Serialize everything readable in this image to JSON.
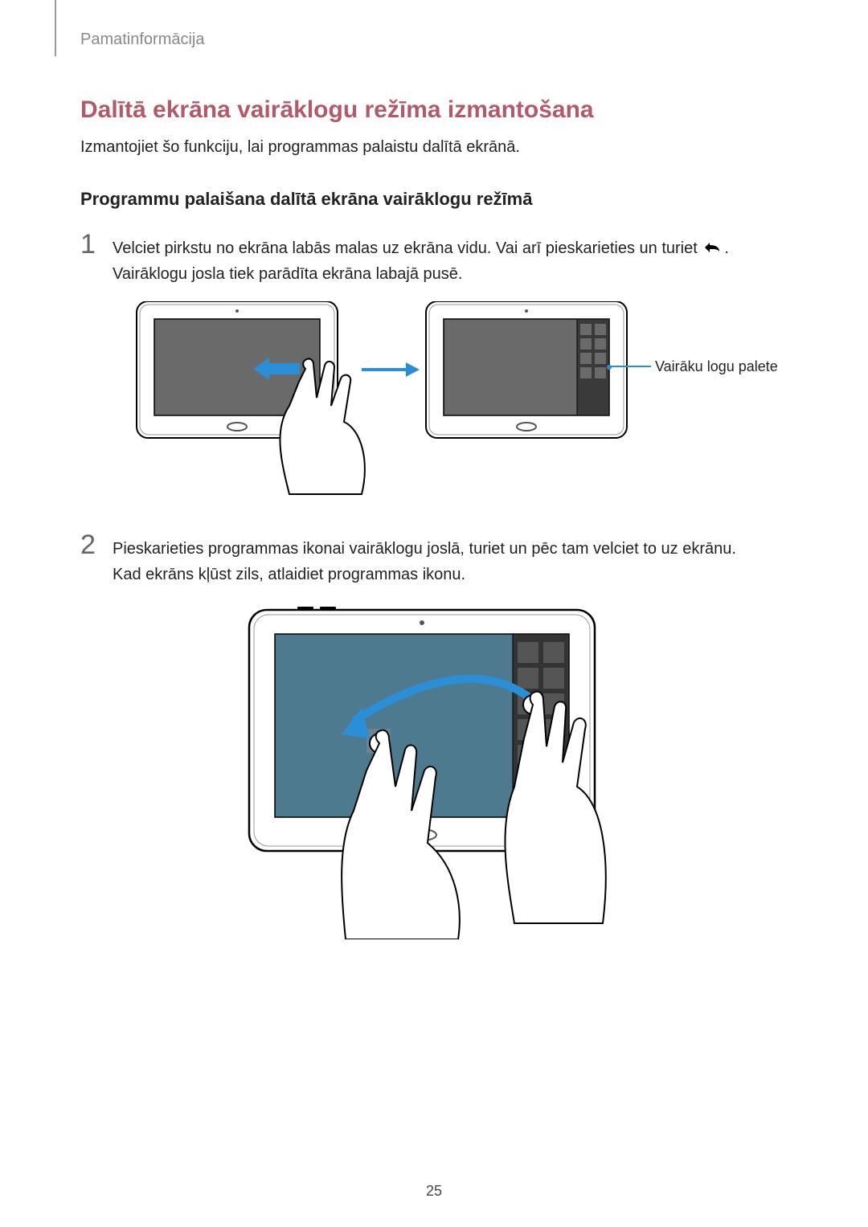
{
  "header": {
    "section": "Pamatinformācija"
  },
  "title": "Dalītā ekrāna vairāklogu režīma izmantošana",
  "intro": "Izmantojiet šo funkciju, lai programmas palaistu dalītā ekrānā.",
  "subtitle": "Programmu palaišana dalītā ekrāna vairāklogu režīmā",
  "steps": {
    "one": {
      "num": "1",
      "line1_a": "Velciet pirkstu no ekrāna labās malas uz ekrāna vidu. Vai arī pieskarieties un turiet ",
      "line1_b": ".",
      "line2": "Vairāklogu josla tiek parādīta ekrāna labajā pusē."
    },
    "two": {
      "num": "2",
      "line1": "Pieskarieties programmas ikonai vairāklogu joslā, turiet un pēc tam velciet to uz ekrānu.",
      "line2": "Kad ekrāns kļūst zils, atlaidiet programmas ikonu."
    }
  },
  "callout": "Vairāku logu palete",
  "page_number": "25"
}
